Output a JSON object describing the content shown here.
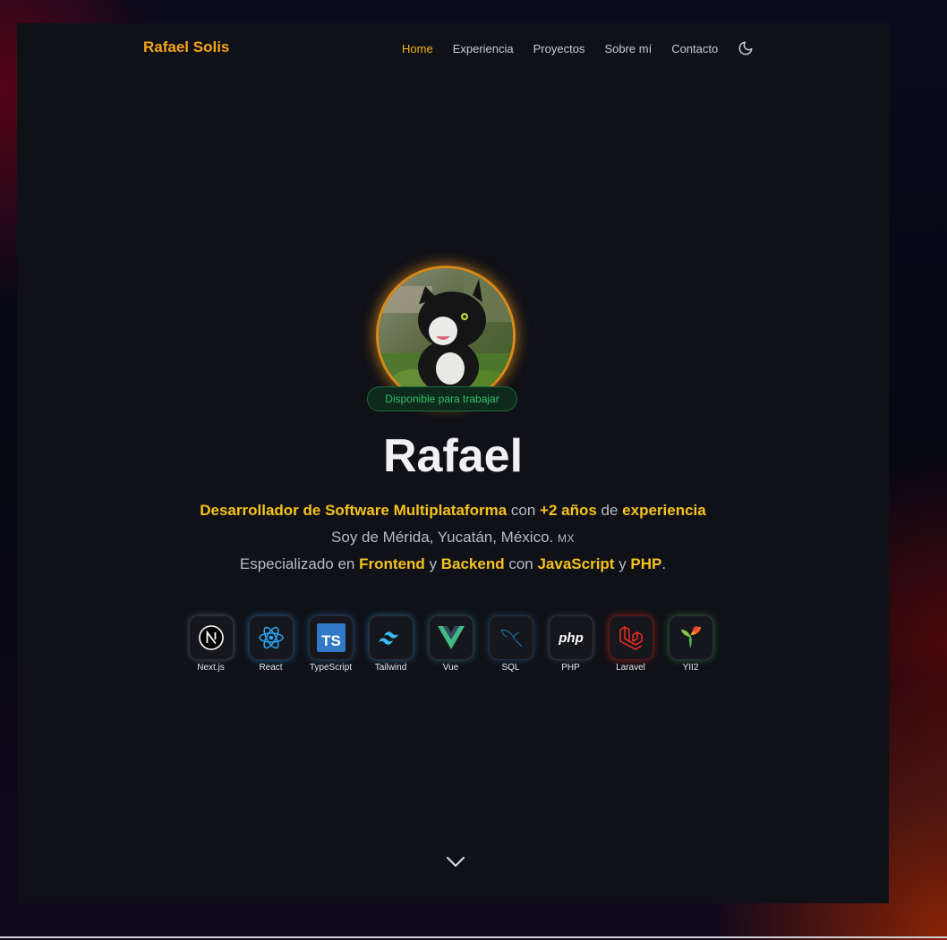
{
  "brand": "Rafael Solis",
  "nav": {
    "items": [
      {
        "label": "Home",
        "active": true
      },
      {
        "label": "Experiencia",
        "active": false
      },
      {
        "label": "Proyectos",
        "active": false
      },
      {
        "label": "Sobre mí",
        "active": false
      },
      {
        "label": "Contacto",
        "active": false
      }
    ],
    "theme_toggle_icon": "moon-icon"
  },
  "hero": {
    "avatar_icon": "cat-avatar-photo",
    "badge": "Disponible para trabajar",
    "name": "Rafael",
    "line1": {
      "role": "Desarrollador de Software Multiplataforma",
      "con": " con ",
      "years": "+2 años",
      "de": " de ",
      "experience": "experiencia"
    },
    "line2": {
      "text": "Soy de Mérida, Yucatán, México. ",
      "flag": "MX"
    },
    "line3": {
      "pre": "Especializado en ",
      "frontend": "Frontend",
      "y1": " y ",
      "backend": "Backend",
      "con": " con ",
      "js": "JavaScript",
      "y2": " y ",
      "php": "PHP",
      "end": "."
    },
    "techs": [
      {
        "label": "Next.js",
        "icon": "nextjs-icon",
        "glow": "#ffffff"
      },
      {
        "label": "React",
        "icon": "react-icon",
        "glow": "#2a9df4"
      },
      {
        "label": "TypeScript",
        "icon": "typescript-icon",
        "glow": "#3178c6"
      },
      {
        "label": "Tailwind",
        "icon": "tailwind-icon",
        "glow": "#38bdf8"
      },
      {
        "label": "Vue",
        "icon": "vue-icon",
        "glow": "#42b883"
      },
      {
        "label": "SQL",
        "icon": "mysql-icon",
        "glow": "#2a6fb0"
      },
      {
        "label": "PHP",
        "icon": "php-icon",
        "glow": "#ffffff"
      },
      {
        "label": "Laravel",
        "icon": "laravel-icon",
        "glow": "#ff2d20"
      },
      {
        "label": "YII2",
        "icon": "yii-icon",
        "glow": "#4caf50"
      }
    ],
    "scroll_icon": "chevron-down-icon"
  },
  "colors": {
    "accent": "#f5c21c",
    "brand": "#f5a418",
    "badge_green": "#34c26a",
    "background": "#0f1117"
  }
}
